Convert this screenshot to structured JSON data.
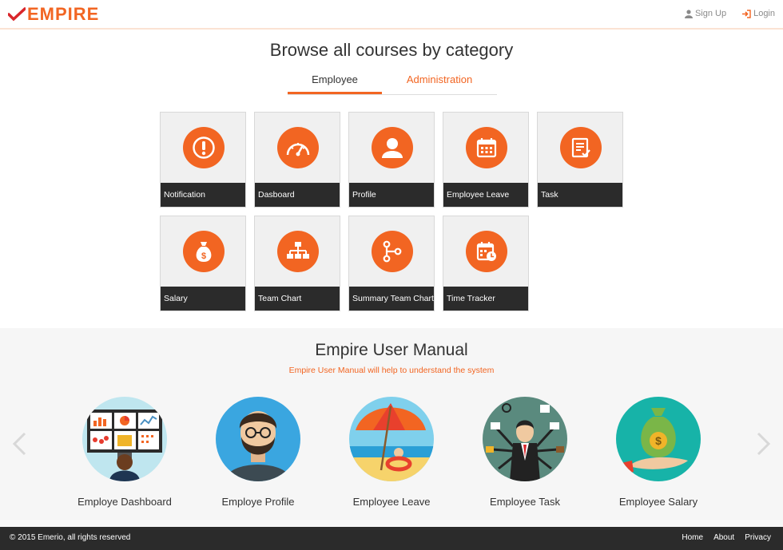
{
  "brand": {
    "name": "EMPIRE",
    "accent": "#f26522",
    "dark": "#2b2b2b"
  },
  "nav": {
    "signup": "Sign Up",
    "login": "Login"
  },
  "page": {
    "heading": "Browse all courses by category"
  },
  "tabs": [
    {
      "label": "Employee",
      "active": true
    },
    {
      "label": "Administration",
      "active": false
    }
  ],
  "tiles": [
    {
      "label": "Notification",
      "icon": "exclamation-icon"
    },
    {
      "label": "Dasboard",
      "icon": "speedometer-icon"
    },
    {
      "label": "Profile",
      "icon": "user-icon"
    },
    {
      "label": "Employee Leave",
      "icon": "calendar-icon"
    },
    {
      "label": "Task",
      "icon": "document-check-icon"
    },
    {
      "label": "Salary",
      "icon": "money-bag-icon"
    },
    {
      "label": "Team Chart",
      "icon": "org-chart-icon"
    },
    {
      "label": "Summary Team Chart",
      "icon": "branch-icon"
    },
    {
      "label": "Time Tracker",
      "icon": "calendar-clock-icon"
    }
  ],
  "manual": {
    "title": "Empire User Manual",
    "subtitle": "Empire User Manual will help to understand the system",
    "cards": [
      {
        "caption": "Employe Dashboard",
        "image": "dashboard-illustration"
      },
      {
        "caption": "Employe Profile",
        "image": "bearded-man-illustration"
      },
      {
        "caption": "Employee Leave",
        "image": "beach-umbrella-illustration"
      },
      {
        "caption": "Employee Task",
        "image": "multitasking-businessman-illustration"
      },
      {
        "caption": "Employee Salary",
        "image": "money-bag-hand-illustration"
      }
    ]
  },
  "footer": {
    "copyright": "© 2015 Emerio, all rights reserved",
    "links": [
      "Home",
      "About",
      "Privacy"
    ]
  }
}
